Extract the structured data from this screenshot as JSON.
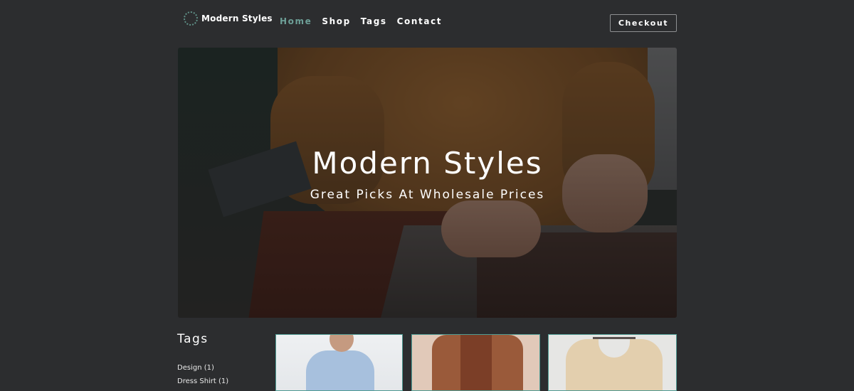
{
  "header": {
    "logo_text": "Modern Styles",
    "nav": [
      {
        "label": "Home",
        "active": true
      },
      {
        "label": "Shop",
        "active": false
      },
      {
        "label": "Tags",
        "active": false
      },
      {
        "label": "Contact",
        "active": false
      }
    ],
    "checkout_label": "Checkout"
  },
  "hero": {
    "title": "Modern Styles",
    "subtitle": "Great Picks At Wholesale Prices"
  },
  "sidebar": {
    "heading": "Tags",
    "tags": [
      "Design (1)",
      "Dress Shirt (1)"
    ]
  },
  "colors": {
    "background": "#2c2d2f",
    "accent": "#6d9f97",
    "card_border": "#4f9b93"
  }
}
